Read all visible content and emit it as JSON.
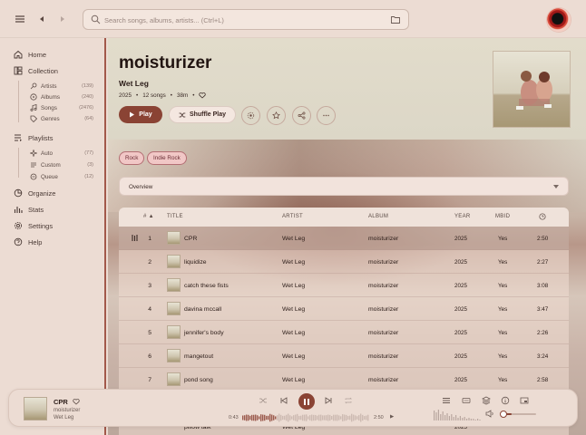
{
  "search": {
    "placeholder": "Search songs, albums, artists... (Ctrl+L)"
  },
  "sidebar": {
    "home": "Home",
    "collection": "Collection",
    "collection_items": [
      {
        "label": "Artists",
        "count": "(139)"
      },
      {
        "label": "Albums",
        "count": "(240)"
      },
      {
        "label": "Songs",
        "count": "(2476)"
      },
      {
        "label": "Genres",
        "count": "(64)"
      }
    ],
    "playlists": "Playlists",
    "playlist_items": [
      {
        "label": "Auto",
        "count": "(77)"
      },
      {
        "label": "Custom",
        "count": "(3)"
      },
      {
        "label": "Queue",
        "count": "(12)"
      }
    ],
    "organize": "Organize",
    "stats": "Stats",
    "settings": "Settings",
    "help": "Help"
  },
  "album": {
    "title": "moisturizer",
    "artist": "Wet Leg",
    "year": "2025",
    "songs": "12 songs",
    "duration": "38m",
    "play_label": "Play",
    "shuffle_label": "Shuffle Play",
    "tags": [
      "Rock",
      "Indie Rock"
    ],
    "overview_label": "Overview"
  },
  "table": {
    "headers": {
      "num": "#",
      "title": "TITLE",
      "artist": "ARTIST",
      "album": "ALBUM",
      "year": "YEAR",
      "mbid": "MBID"
    },
    "rows": [
      {
        "num": "1",
        "title": "CPR",
        "artist": "Wet Leg",
        "album": "moisturizer",
        "year": "2025",
        "mbid": "Yes",
        "duration": "2:50"
      },
      {
        "num": "2",
        "title": "liquidize",
        "artist": "Wet Leg",
        "album": "moisturizer",
        "year": "2025",
        "mbid": "Yes",
        "duration": "2:27"
      },
      {
        "num": "3",
        "title": "catch these fists",
        "artist": "Wet Leg",
        "album": "moisturizer",
        "year": "2025",
        "mbid": "Yes",
        "duration": "3:08"
      },
      {
        "num": "4",
        "title": "davina mccall",
        "artist": "Wet Leg",
        "album": "moisturizer",
        "year": "2025",
        "mbid": "Yes",
        "duration": "3:47"
      },
      {
        "num": "5",
        "title": "jennifer's body",
        "artist": "Wet Leg",
        "album": "moisturizer",
        "year": "2025",
        "mbid": "Yes",
        "duration": "2:26"
      },
      {
        "num": "6",
        "title": "mangetout",
        "artist": "Wet Leg",
        "album": "moisturizer",
        "year": "2025",
        "mbid": "Yes",
        "duration": "3:24"
      },
      {
        "num": "7",
        "title": "pond song",
        "artist": "Wet Leg",
        "album": "moisturizer",
        "year": "2025",
        "mbid": "Yes",
        "duration": "2:58"
      }
    ],
    "partial_row": {
      "title": "pillow talk",
      "artist": "Wet Leg",
      "year": "2025"
    }
  },
  "player": {
    "title": "CPR",
    "album": "moisturizer",
    "artist": "Wet Leg",
    "elapsed": "0:43",
    "total": "2:50",
    "progress": 0.25,
    "volume": 0.25
  },
  "colors": {
    "accent": "#8a4334",
    "tag_bg": "#f1c7c6",
    "sidebar_border": "#a2584a"
  }
}
